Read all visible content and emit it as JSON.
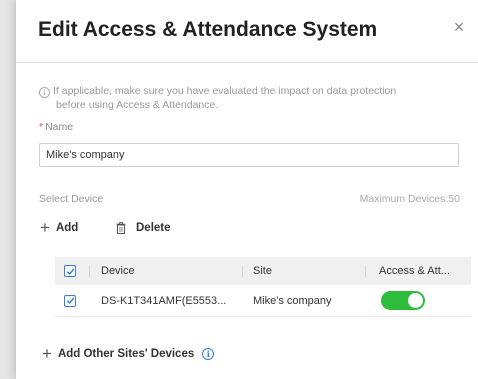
{
  "dialog": {
    "title": "Edit Access & Attendance System",
    "close_glyph": "×",
    "notice_icon": "i",
    "notice_line1": "If applicable, make sure you have evaluated the impact on data protection",
    "notice_line2": "before using Access & Attendance."
  },
  "name_field": {
    "required_mark": "*",
    "label": "Name",
    "value": "Mike's company"
  },
  "device_section": {
    "label": "Select Device",
    "max_label": "Maximum Devices:50",
    "add_label": "Add",
    "delete_label": "Delete"
  },
  "table": {
    "columns": [
      "Device",
      "Site",
      "Access & Att..."
    ],
    "rows": [
      {
        "device": "DS-K1T341AMF(E5553...",
        "site": "Mike's company",
        "selected": true,
        "access_enabled": true
      }
    ]
  },
  "footer": {
    "add_other_label": "Add Other Sites' Devices",
    "info_glyph": "i"
  },
  "colors": {
    "accent": "#2f7de1",
    "toggle_on": "#2ebd3b",
    "required": "#e34d4d"
  },
  "icons": [
    "close-icon",
    "info-icon",
    "plus-icon",
    "trash-icon",
    "checkbox-checked-icon",
    "toggle-switch"
  ]
}
